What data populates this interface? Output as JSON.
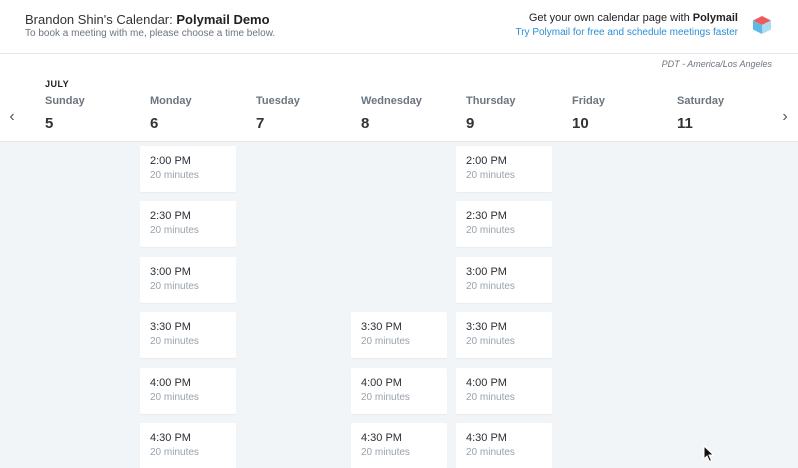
{
  "header": {
    "title_prefix": "Brandon Shin's Calendar: ",
    "title_name": "Polymail Demo",
    "subtitle": "To book a meeting with me, please choose a time below.",
    "promo_prefix": "Get your own calendar page with ",
    "promo_brand": "Polymail",
    "promo_link": "Try Polymail for free and schedule meetings faster"
  },
  "timezone": "PDT - America/Los Angeles",
  "month": "JULY",
  "nav": {
    "prev": "‹",
    "next": "›"
  },
  "days": [
    {
      "name": "Sunday",
      "date": "5"
    },
    {
      "name": "Monday",
      "date": "6"
    },
    {
      "name": "Tuesday",
      "date": "7"
    },
    {
      "name": "Wednesday",
      "date": "8"
    },
    {
      "name": "Thursday",
      "date": "9"
    },
    {
      "name": "Friday",
      "date": "10"
    },
    {
      "name": "Saturday",
      "date": "11"
    }
  ],
  "slots": {
    "monday": [
      {
        "time": "2:00 PM",
        "duration": "20 minutes"
      },
      {
        "time": "2:30 PM",
        "duration": "20 minutes"
      },
      {
        "time": "3:00 PM",
        "duration": "20 minutes"
      },
      {
        "time": "3:30 PM",
        "duration": "20 minutes"
      },
      {
        "time": "4:00 PM",
        "duration": "20 minutes"
      },
      {
        "time": "4:30 PM",
        "duration": "20 minutes"
      }
    ],
    "wednesday": [
      {
        "time": "3:30 PM",
        "duration": "20 minutes"
      },
      {
        "time": "4:00 PM",
        "duration": "20 minutes"
      },
      {
        "time": "4:30 PM",
        "duration": "20 minutes"
      }
    ],
    "thursday": [
      {
        "time": "2:00 PM",
        "duration": "20 minutes"
      },
      {
        "time": "2:30 PM",
        "duration": "20 minutes"
      },
      {
        "time": "3:00 PM",
        "duration": "20 minutes"
      },
      {
        "time": "3:30 PM",
        "duration": "20 minutes"
      },
      {
        "time": "4:00 PM",
        "duration": "20 minutes"
      },
      {
        "time": "4:30 PM",
        "duration": "20 minutes"
      }
    ]
  },
  "colors": {
    "link": "#2d8fd5",
    "grid_background": "#f2f5f8",
    "muted_text": "#98a2ac"
  }
}
